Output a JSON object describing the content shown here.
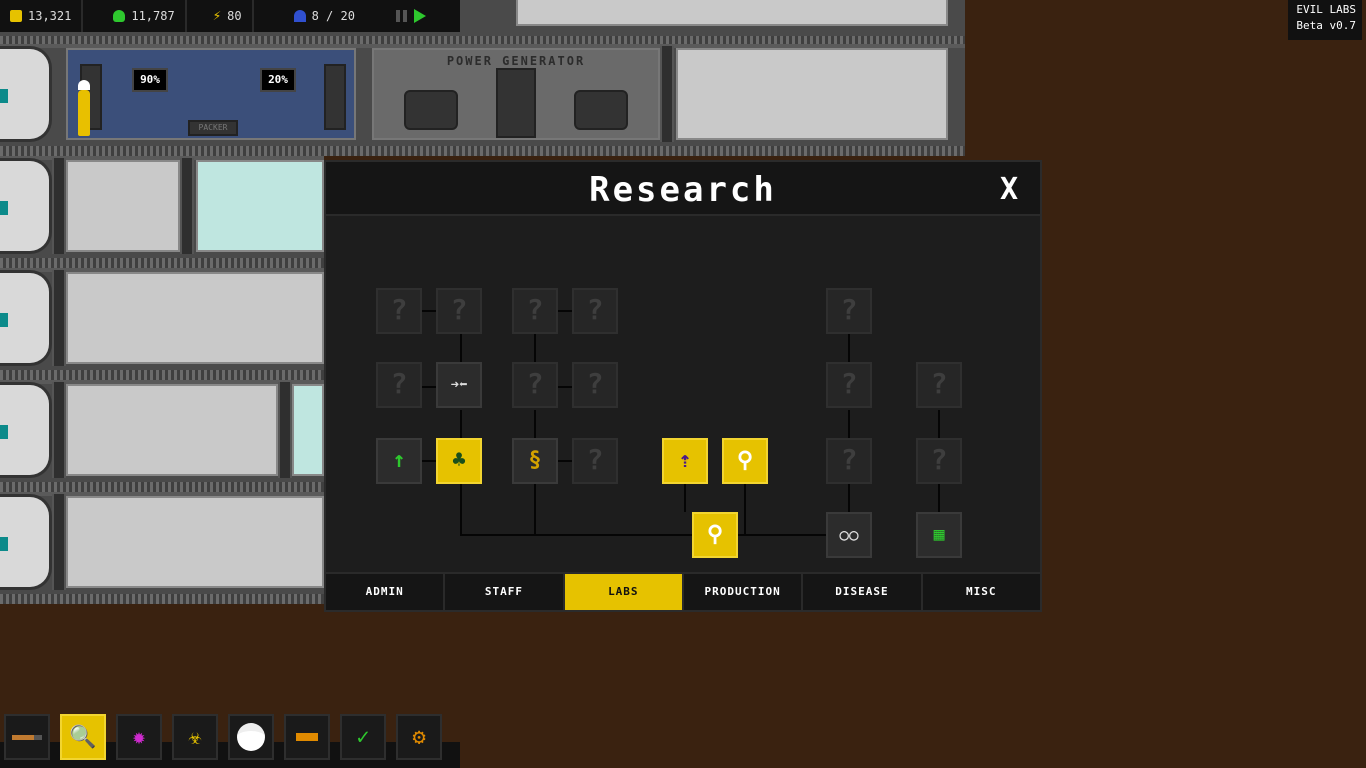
{
  "resources": {
    "money": "13,321",
    "chemicals": "11,787",
    "power": "80",
    "staff": "8 / 20"
  },
  "version": {
    "name": "EVIL LABS",
    "build": "Beta v0.7"
  },
  "rooms": {
    "generator_label": "POWER GENERATOR",
    "lab_progress": [
      "90%",
      "20%"
    ],
    "packer_label": "PACKER"
  },
  "research": {
    "title": "Research",
    "close_label": "X",
    "unknown_mark": "?",
    "tabs": [
      "ADMIN",
      "STAFF",
      "LABS",
      "PRODUCTION",
      "DISEASE",
      "MISC"
    ],
    "selected_tab": "LABS"
  },
  "toolbar": {
    "items": [
      "build-hammer",
      "research-monitor",
      "virus",
      "biohazard",
      "staff-helmet",
      "evil-syringe",
      "clipboard-check",
      "settings-gear"
    ],
    "selected": "research-monitor"
  },
  "colors": {
    "accent": "#e6c200",
    "panel": "#1d1d1d",
    "background": "#3a2210"
  }
}
